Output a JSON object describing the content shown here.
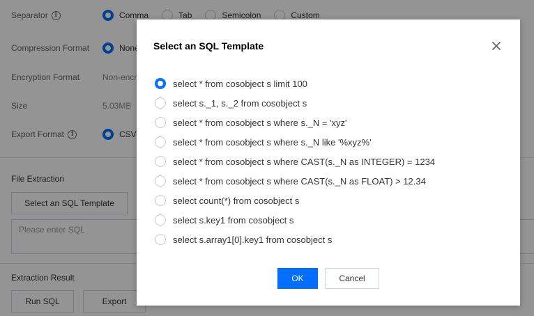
{
  "form": {
    "separator": {
      "label": "Separator",
      "options": [
        "Comma",
        "Tab",
        "Semicolon",
        "Custom"
      ],
      "selected_index": 0
    },
    "compression": {
      "label": "Compression Format",
      "value": "None"
    },
    "encryption": {
      "label": "Encryption Format",
      "value": "Non-encrypted"
    },
    "size": {
      "label": "Size",
      "value": "5.03MB"
    },
    "export_format": {
      "label": "Export Format",
      "value": "CSV"
    },
    "file_extraction": {
      "title": "File Extraction",
      "select_template_button": "Select an SQL Template",
      "sql_placeholder": "Please enter SQL"
    },
    "extraction_result": {
      "title": "Extraction Result",
      "run_button": "Run SQL",
      "export_button": "Export"
    }
  },
  "modal": {
    "title": "Select an SQL Template",
    "selected_index": 0,
    "templates": [
      "select * from cosobject s limit 100",
      "select s._1, s._2 from cosobject s",
      "select * from cosobject s where s._N = 'xyz'",
      "select * from cosobject s where s._N like '%xyz%'",
      "select * from cosobject s where CAST(s._N as INTEGER) = 1234",
      "select * from cosobject s where CAST(s._N as FLOAT) > 12.34",
      "select count(*) from cosobject s",
      "select s.key1 from cosobject s",
      "select s.array1[0].key1 from cosobject s"
    ],
    "ok_label": "OK",
    "cancel_label": "Cancel"
  },
  "colors": {
    "accent": "#006eff",
    "mask": "rgba(0,0,0,0.42)"
  }
}
